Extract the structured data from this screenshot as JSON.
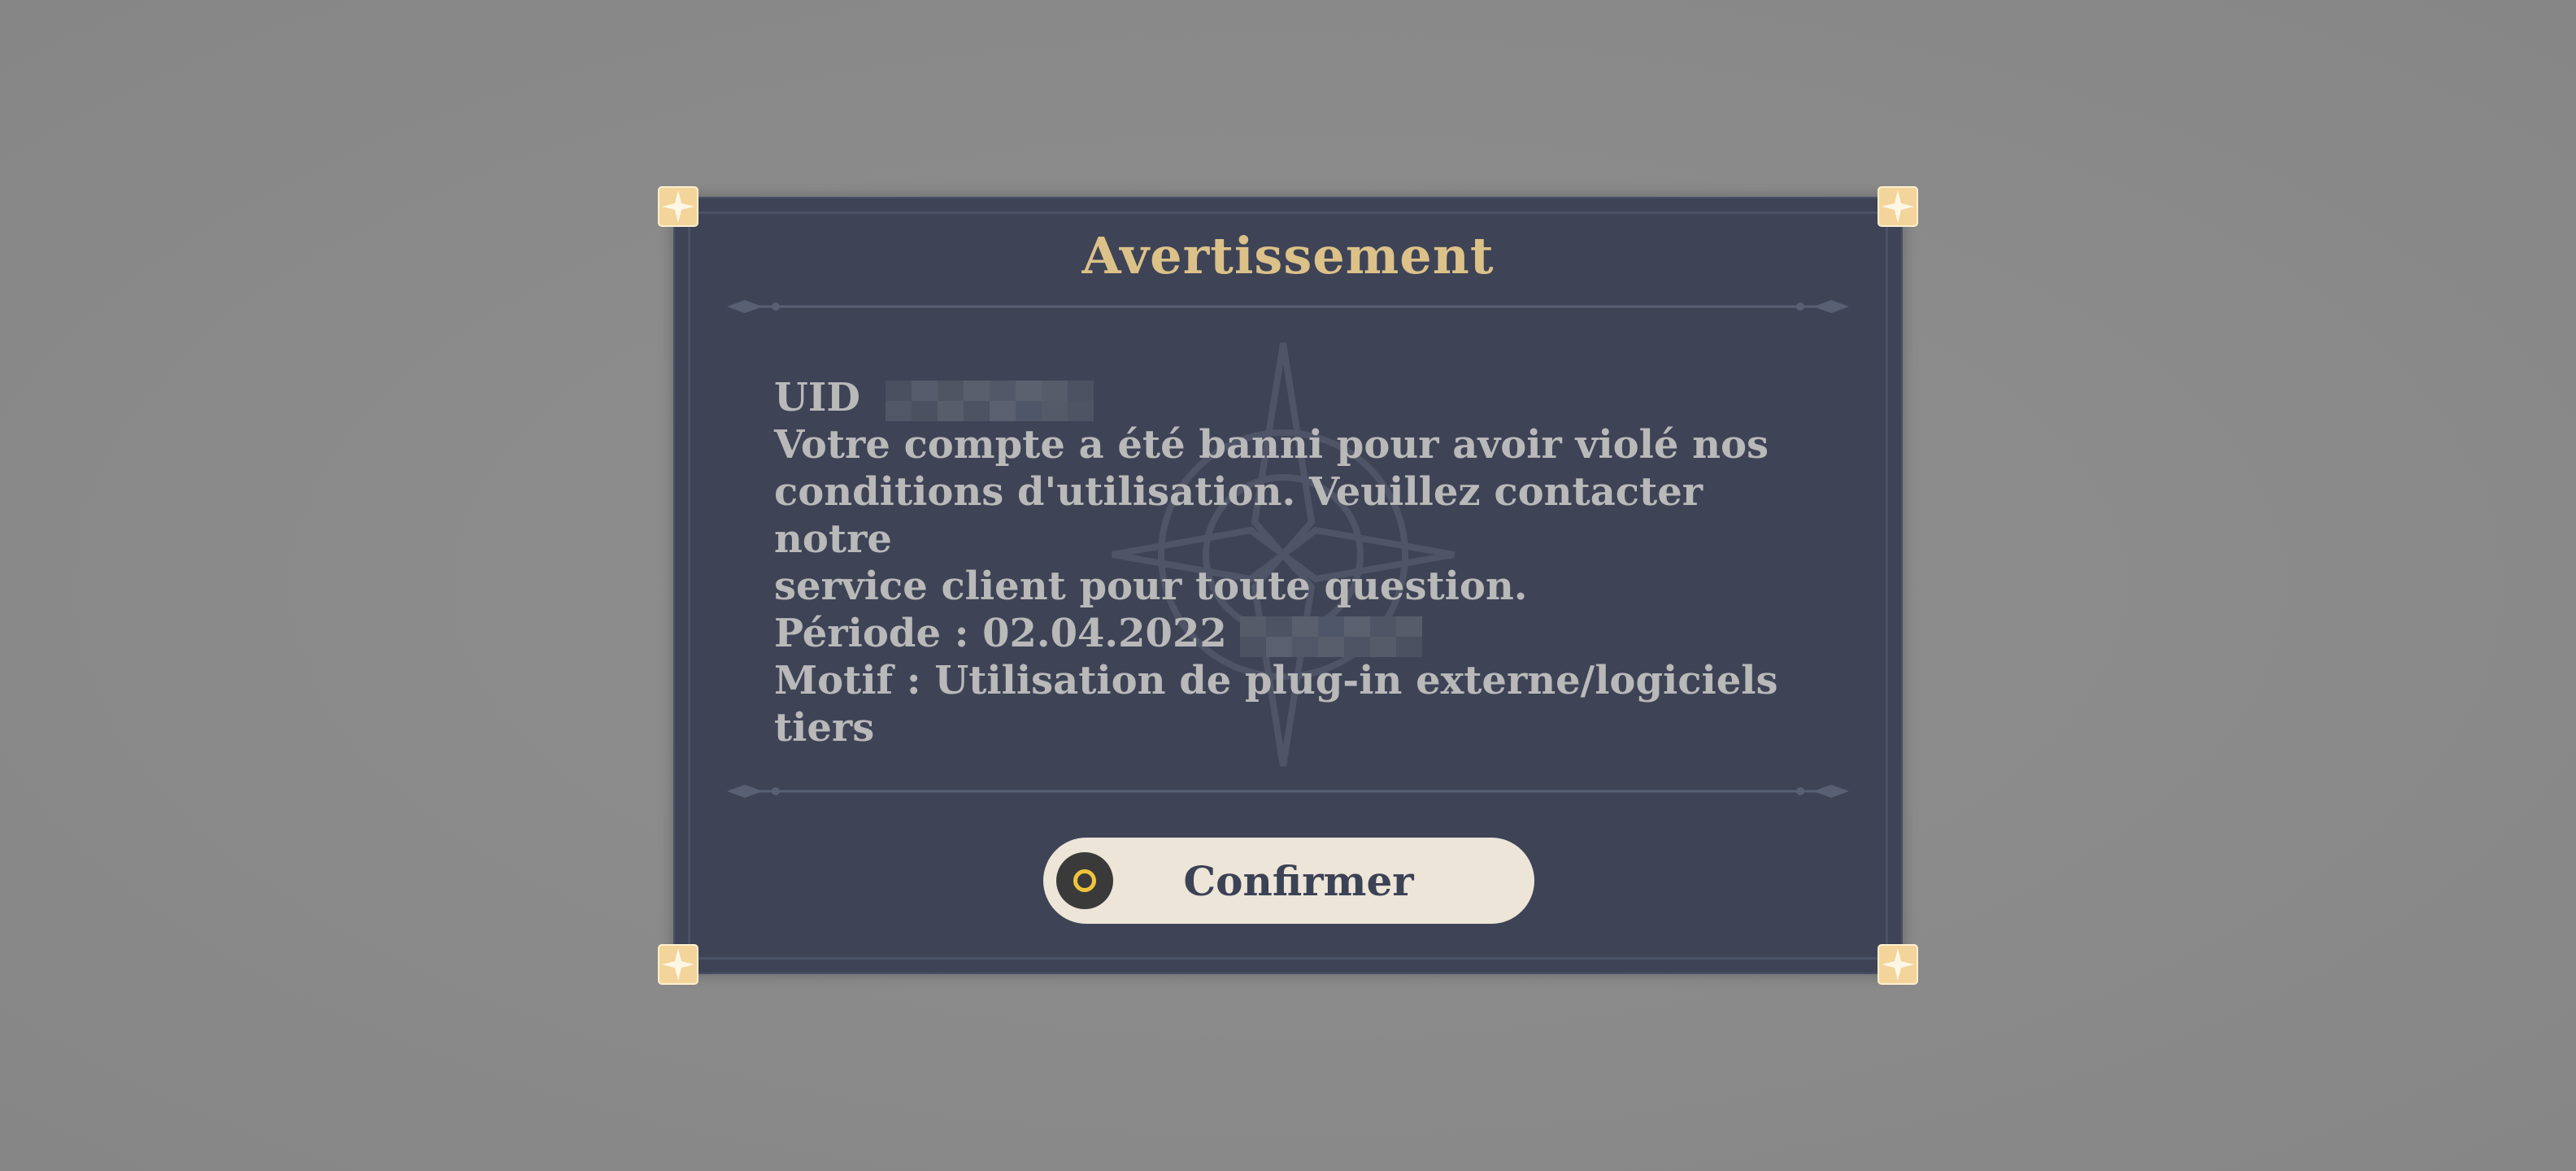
{
  "dialog": {
    "title": "Avertissement",
    "uid_label": "UID",
    "message_lines": [
      "Votre compte a été banni pour avoir violé nos",
      "conditions d'utilisation. Veuillez contacter notre",
      "service client pour toute question."
    ],
    "period_text": "Période : 02.04.2022",
    "reason_lines": [
      "Motif : Utilisation de plug-in externe/logiciels",
      "tiers"
    ],
    "confirm_label": "Confirmer",
    "confirm_icon": "circle-button-icon"
  },
  "colors": {
    "background": "#8b8b8b",
    "panel": "#3e4456",
    "title": "#dcc189",
    "body_text": "#b9b9b9",
    "button_bg": "#ece5d8",
    "button_text": "#3b4255",
    "button_icon_ring": "#f0c43a"
  }
}
